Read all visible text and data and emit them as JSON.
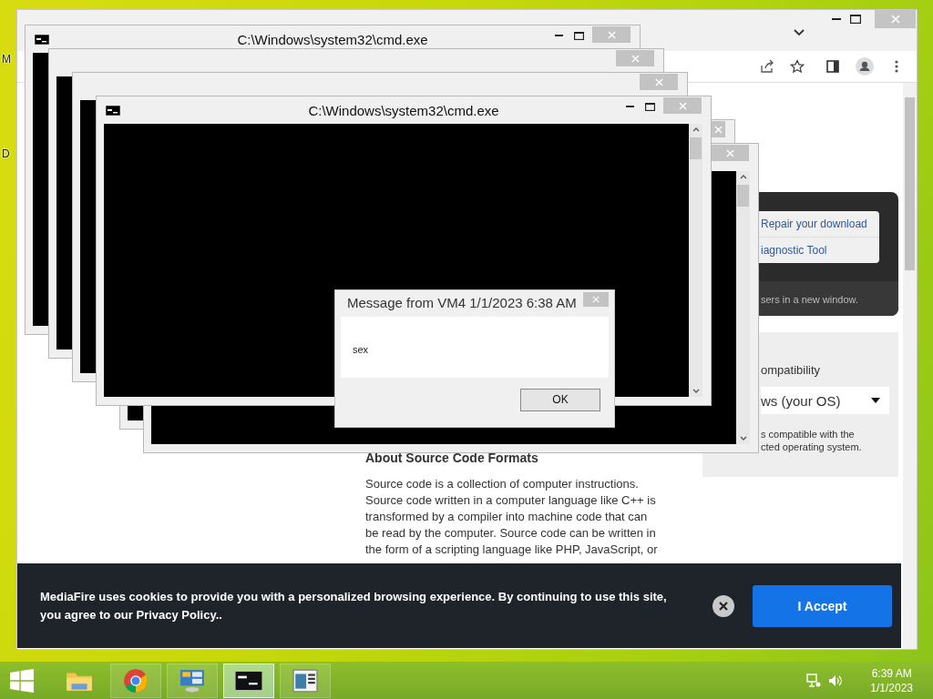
{
  "desktop": {
    "icon_labels": [
      "M",
      "D"
    ]
  },
  "browser": {
    "download_links": [
      {
        "text": "Repair your download"
      },
      {
        "text": "iagnostic Tool"
      }
    ],
    "notice": "sers in a new window.",
    "compat": {
      "label": "ompatibility",
      "select_value": "ws (your OS)",
      "note": "s compatible with the\ncted operating system."
    },
    "article": {
      "heading": "About Source Code Formats",
      "paragraph": "Source code is a collection of computer instructions. Source code written in a computer language like C++ is transformed by a compiler into machine code that can be read by the computer. Source code can be written in the form of a scripting language like PHP, JavaScript, or"
    },
    "cookie_banner": {
      "text": "MediaFire uses cookies to provide you with a personalized browsing experience. By continuing to use this site, you agree to our Privacy Policy..",
      "button": "I Accept"
    }
  },
  "cmd_windows": [
    {
      "title": "C:\\Windows\\system32\\cmd.exe"
    },
    {
      "title": "C:\\Windows\\system32\\cmd.exe"
    }
  ],
  "dialog": {
    "title": "Message from VM4 1/1/2023 6:38 AM",
    "message": "sex",
    "button": "OK"
  },
  "taskbar": {
    "apps": [
      {
        "kind": "folder",
        "selected": false
      },
      {
        "kind": "browser",
        "selected": false
      },
      {
        "kind": "control-panel",
        "selected": false
      },
      {
        "kind": "console",
        "selected": true
      },
      {
        "kind": "document",
        "selected": false
      }
    ],
    "clock": {
      "time": "6:39 AM",
      "date": "1/1/2023"
    }
  }
}
